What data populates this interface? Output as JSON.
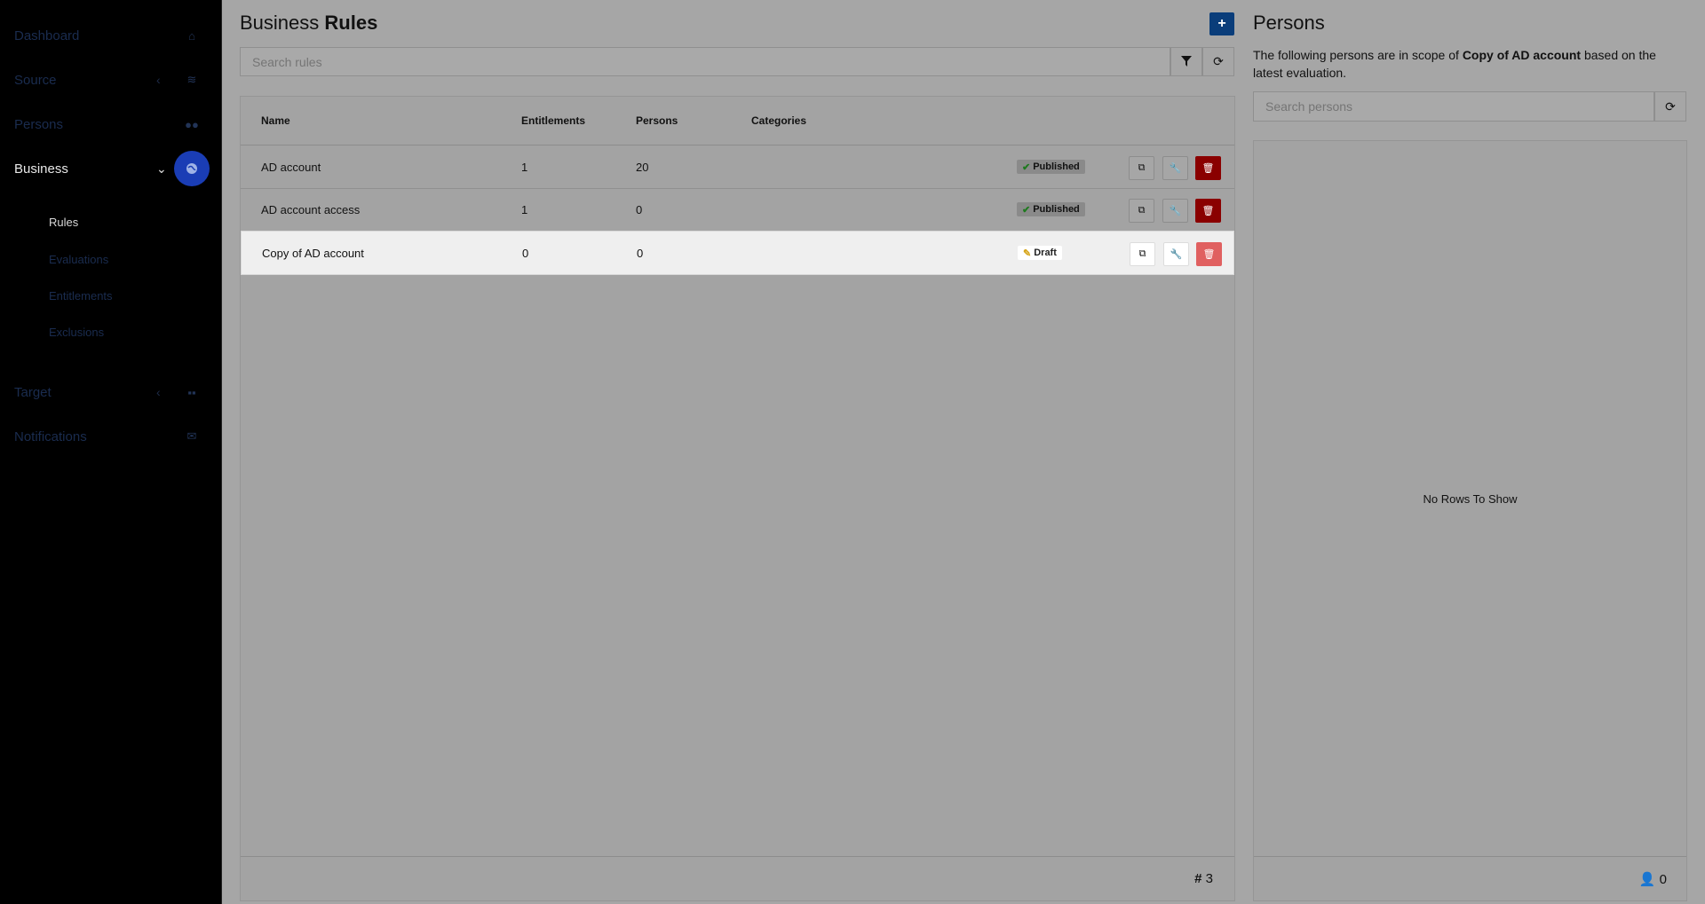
{
  "sidebar": {
    "items": [
      {
        "label": "Dashboard",
        "icon": "home-icon"
      },
      {
        "label": "Source",
        "icon": "layers-icon"
      },
      {
        "label": "Persons",
        "icon": "users-icon"
      },
      {
        "label": "Business",
        "icon": "globe-icon"
      },
      {
        "label": "Target",
        "icon": "grid-icon"
      },
      {
        "label": "Notifications",
        "icon": "envelope-icon"
      }
    ],
    "business_sub": [
      "Rules",
      "Evaluations",
      "Entitlements",
      "Exclusions"
    ],
    "active_item": "Business",
    "active_sub": "Rules"
  },
  "header": {
    "title_light": "Business",
    "title_bold": "Rules",
    "add_label": "+",
    "search_placeholder": "Search rules"
  },
  "table": {
    "columns": [
      "Name",
      "Entitlements",
      "Persons",
      "Categories"
    ],
    "rows": [
      {
        "name": "AD account",
        "entitlements": "1",
        "persons": "20",
        "status": "Published"
      },
      {
        "name": "AD account access",
        "entitlements": "1",
        "persons": "0",
        "status": "Published"
      },
      {
        "name": "Copy of AD account",
        "entitlements": "0",
        "persons": "0",
        "status": "Draft"
      }
    ],
    "footer_count": "3"
  },
  "persons": {
    "title": "Persons",
    "desc_pre": "The following persons are in scope of ",
    "desc_bold": "Copy of AD account",
    "desc_post": " based on the latest evaluation.",
    "search_placeholder": "Search persons",
    "empty_text": "No Rows To Show",
    "footer_count": "0"
  },
  "colors": {
    "sidebar_bg": "#000000",
    "active_circle": "#1a3db5",
    "add_button": "#0a3d7a",
    "delete_button": "#8a0000"
  }
}
